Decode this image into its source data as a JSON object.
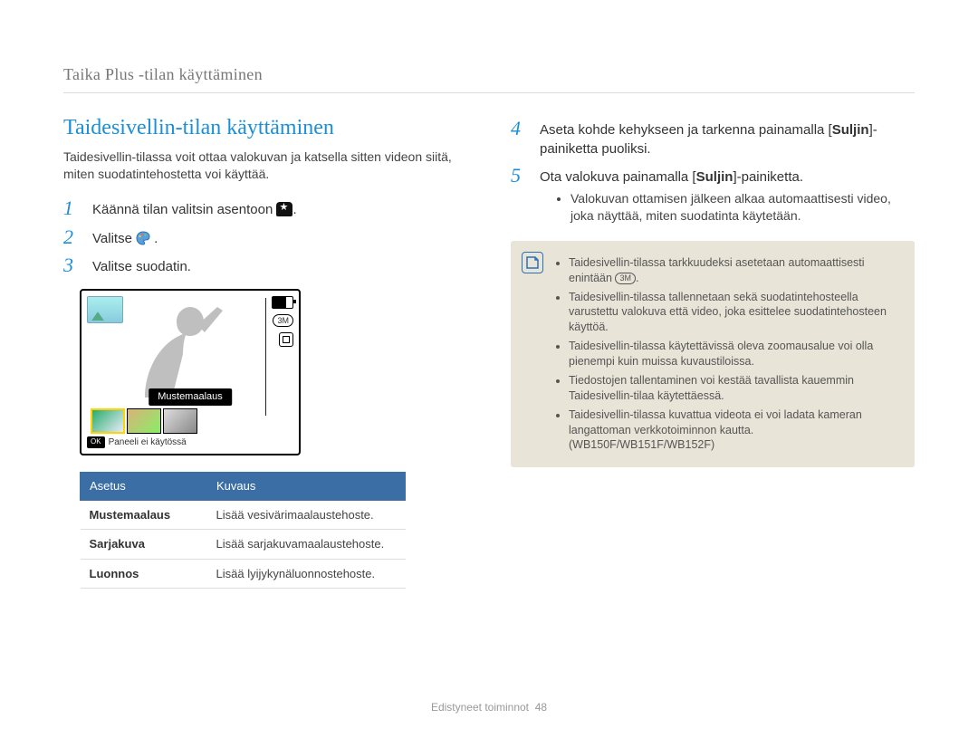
{
  "section_header": "Taika Plus -tilan käyttäminen",
  "title": "Taidesivellin-tilan käyttäminen",
  "intro": "Taidesivellin-tilassa voit ottaa valokuvan ja katsella sitten videon siitä, miten suodatintehostetta voi käyttää.",
  "steps_left": [
    {
      "num": "1",
      "text_before": "Käännä tilan valitsin asentoon ",
      "icon": "dial-star",
      "text_after": "."
    },
    {
      "num": "2",
      "text_before": "Valitse ",
      "icon": "palette",
      "text_after": "."
    },
    {
      "num": "3",
      "text_before": "Valitse suodatin.",
      "icon": null,
      "text_after": ""
    }
  ],
  "screenshot": {
    "filter_label": "Mustemaalaus",
    "footer_text": "Paneeli ei käytössä",
    "ok_label": "OK",
    "res_badge": "3M"
  },
  "table": {
    "headers": [
      "Asetus",
      "Kuvaus"
    ],
    "rows": [
      [
        "Mustemaalaus",
        "Lisää vesivärimaalaustehoste."
      ],
      [
        "Sarjakuva",
        "Lisää sarjakuvamaalaustehoste."
      ],
      [
        "Luonnos",
        "Lisää lyijykynäluonnostehoste."
      ]
    ]
  },
  "steps_right": [
    {
      "num": "4",
      "parts": [
        "Aseta kohde kehykseen ja tarkenna painamalla [",
        "Suljin",
        "]-painiketta puoliksi."
      ]
    },
    {
      "num": "5",
      "parts": [
        "Ota valokuva painamalla [",
        "Suljin",
        "]-painiketta."
      ],
      "sub": [
        "Valokuvan ottamisen jälkeen alkaa automaattisesti video, joka näyttää, miten suodatinta käytetään."
      ]
    }
  ],
  "note": {
    "items": [
      {
        "before": "Taidesivellin-tilassa tarkkuudeksi asetetaan automaattisesti enintään ",
        "pill": "3M",
        "after": "."
      },
      {
        "text": "Taidesivellin-tilassa tallennetaan sekä suodatintehosteella varustettu valokuva että video, joka esittelee suodatintehosteen käyttöä."
      },
      {
        "text": "Taidesivellin-tilassa käytettävissä oleva zoomausalue voi olla pienempi kuin muissa kuvaustiloissa."
      },
      {
        "text": "Tiedostojen tallentaminen voi kestää tavallista kauemmin Taidesivellin-tilaa käytettäessä."
      },
      {
        "text": "Taidesivellin-tilassa kuvattua videota ei voi ladata kameran langattoman verkkotoiminnon kautta. (WB150F/WB151F/WB152F)"
      }
    ]
  },
  "footer": {
    "section": "Edistyneet toiminnot",
    "page": "48"
  }
}
